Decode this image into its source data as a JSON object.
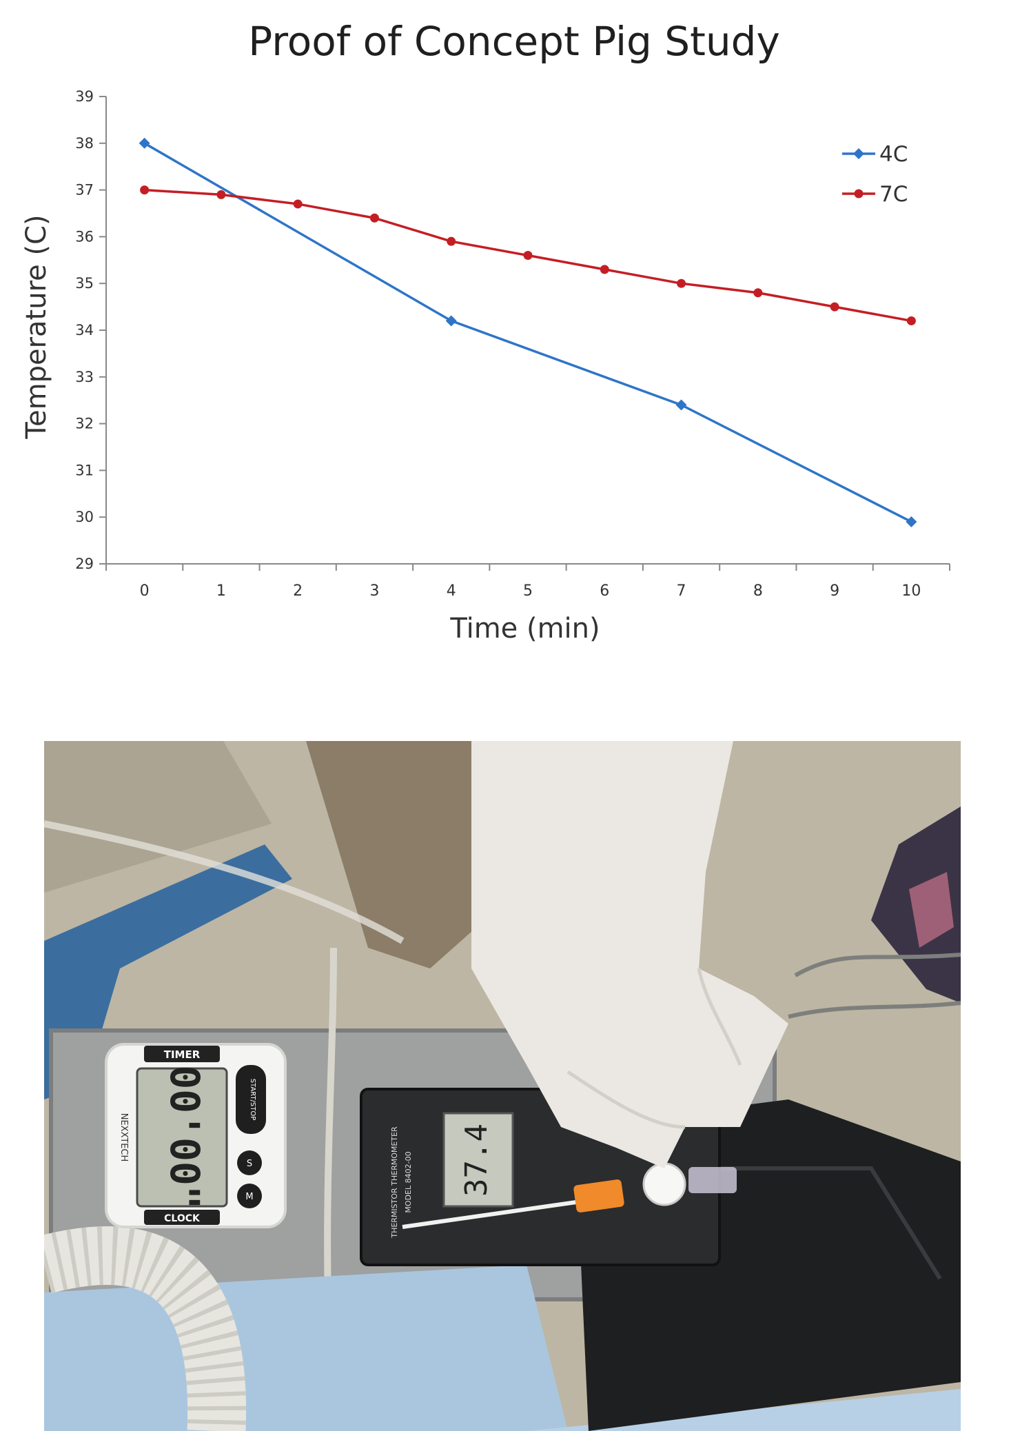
{
  "chart_data": {
    "type": "line",
    "title": "Proof of Concept Pig Study",
    "xlabel": "Time (min)",
    "ylabel": "Temperature (C)",
    "x_categories": [
      "0",
      "1",
      "2",
      "3",
      "4",
      "5",
      "6",
      "7",
      "8",
      "9",
      "10"
    ],
    "y_ticks": [
      "29",
      "30",
      "31",
      "32",
      "33",
      "34",
      "35",
      "36",
      "37",
      "38",
      "39"
    ],
    "ylim": [
      29,
      39
    ],
    "grid": false,
    "legend_position": "top-right",
    "series": [
      {
        "name": "4C",
        "color": "#2e75c8",
        "marker": "diamond",
        "points": [
          [
            0,
            38.0
          ],
          [
            4,
            34.2
          ],
          [
            7,
            32.4
          ],
          [
            10,
            29.9
          ]
        ]
      },
      {
        "name": "7C",
        "color": "#c41e24",
        "marker": "circle",
        "points": [
          [
            0,
            37.0
          ],
          [
            1,
            36.9
          ],
          [
            2,
            36.7
          ],
          [
            3,
            36.4
          ],
          [
            4,
            35.9
          ],
          [
            5,
            35.6
          ],
          [
            6,
            35.3
          ],
          [
            7,
            35.0
          ],
          [
            8,
            34.8
          ],
          [
            9,
            34.5
          ],
          [
            10,
            34.2
          ]
        ]
      }
    ]
  },
  "photo": {
    "timer_brand": "NEXXTECH",
    "timer_top": "TIMER",
    "timer_bottom": "CLOCK",
    "timer_display": "00'00\"",
    "timer_button_main": "START/STOP",
    "timer_button_s": "S",
    "timer_button_m": "M",
    "thermometer_label": "THERMISTOR THERMOMETER",
    "thermometer_model": "MODEL 8402-00",
    "thermometer_display": "37.4"
  }
}
